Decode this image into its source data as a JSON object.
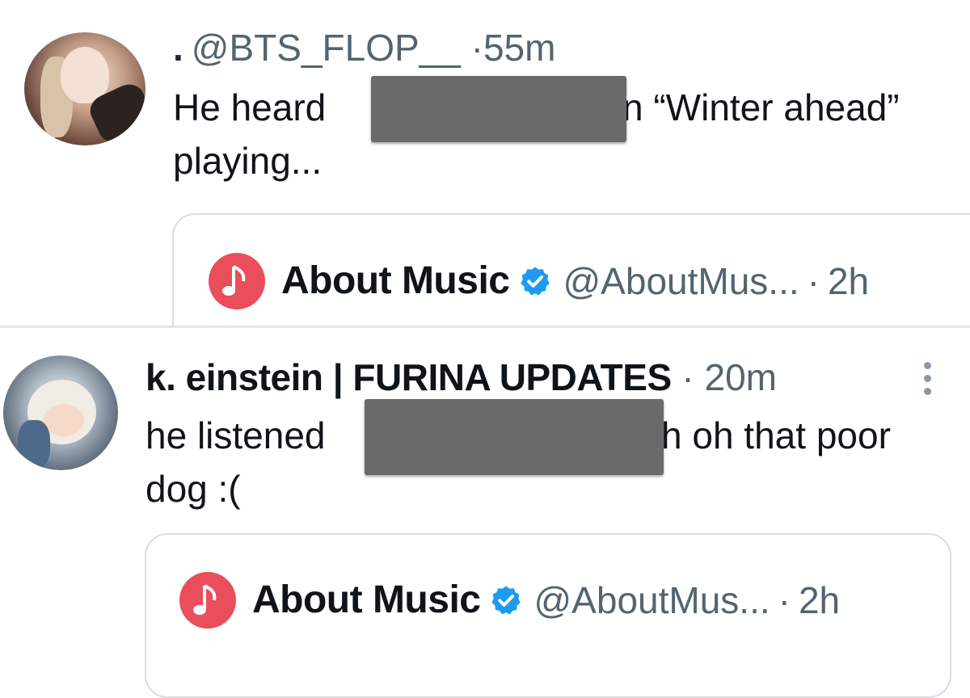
{
  "tweets": [
    {
      "prefix": ".",
      "handle": "@BTS_FLOP__",
      "separator": "·",
      "time": "55m",
      "body_line1_start": "He heard",
      "body_line1_end": "n “Winter ahead”",
      "body_line2": "playing...",
      "quote": {
        "name": "About Music",
        "handle": "@AboutMus...",
        "separator": "·",
        "time": "2h",
        "logo_icon": "music-note-icon",
        "logo_color": "#e94e5a"
      }
    },
    {
      "name": "k. einstein | FURINA UPDATES",
      "separator": "·",
      "time": "20m",
      "body_line1_start": "he listened",
      "body_line1_end": "h oh that poor",
      "body_line2": "dog :(",
      "quote": {
        "name": "About Music",
        "handle": "@AboutMus...",
        "separator": "·",
        "time": "2h",
        "logo_icon": "music-note-icon",
        "logo_color": "#e94e5a"
      }
    }
  ],
  "colors": {
    "verified": "#1d9bf0",
    "secondary_text": "#536471",
    "redaction": "#6a6a6a"
  }
}
